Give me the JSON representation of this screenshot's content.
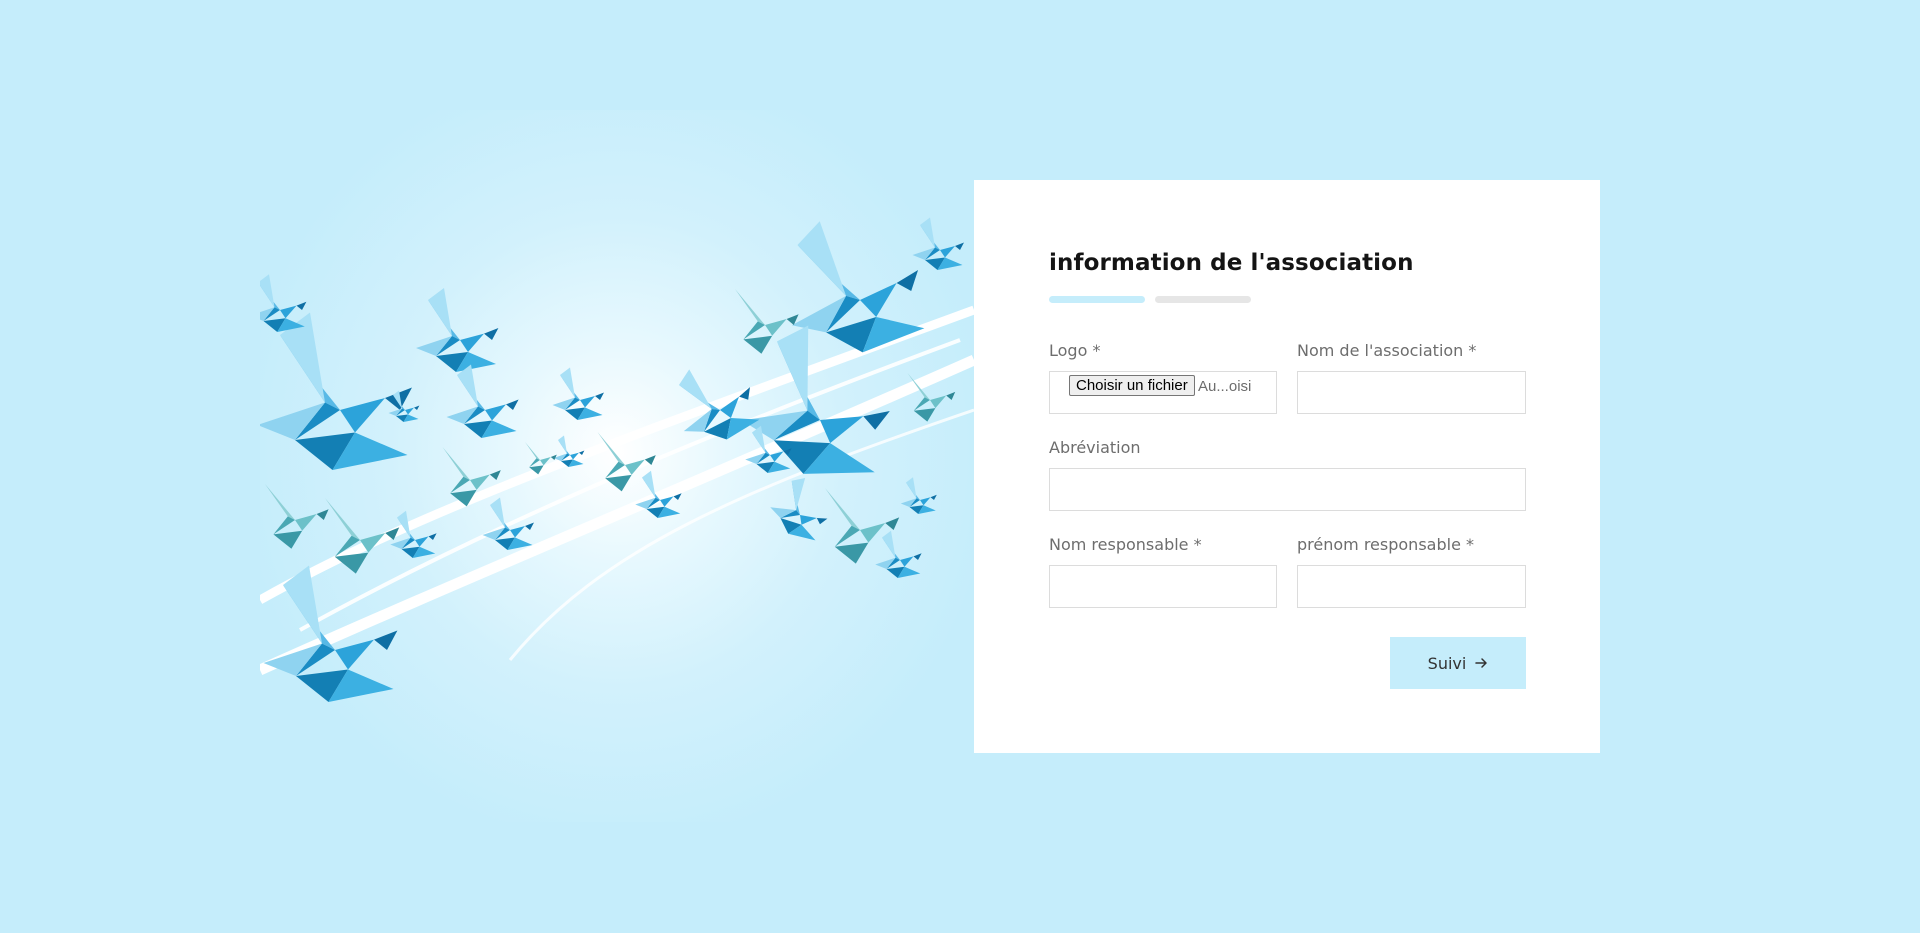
{
  "form": {
    "title": "information de l'association",
    "progress": {
      "current_step": 1,
      "total_steps": 2
    },
    "fields": {
      "logo": {
        "label": "Logo *",
        "button_label": "Choisir un fichier",
        "status_text": "Au...oisi"
      },
      "nom_association": {
        "label": "Nom de l'association *",
        "value": ""
      },
      "abreviation": {
        "label": "Abréviation",
        "value": ""
      },
      "nom_responsable": {
        "label": "Nom responsable *",
        "value": ""
      },
      "prenom_responsable": {
        "label": "prénom responsable *",
        "value": ""
      }
    },
    "next_button": {
      "label": "Suivi",
      "icon": "arrow-right-icon"
    }
  },
  "illustration": {
    "subject": "origami-birds",
    "icon": "origami-birds-illustration"
  },
  "colors": {
    "page_background": "#c5edfb",
    "accent": "#c5edfb",
    "card_background": "#ffffff",
    "bird_primary": "#1e9fd6",
    "bird_secondary": "#6cc1c9",
    "progress_inactive": "#e6e6e6"
  }
}
